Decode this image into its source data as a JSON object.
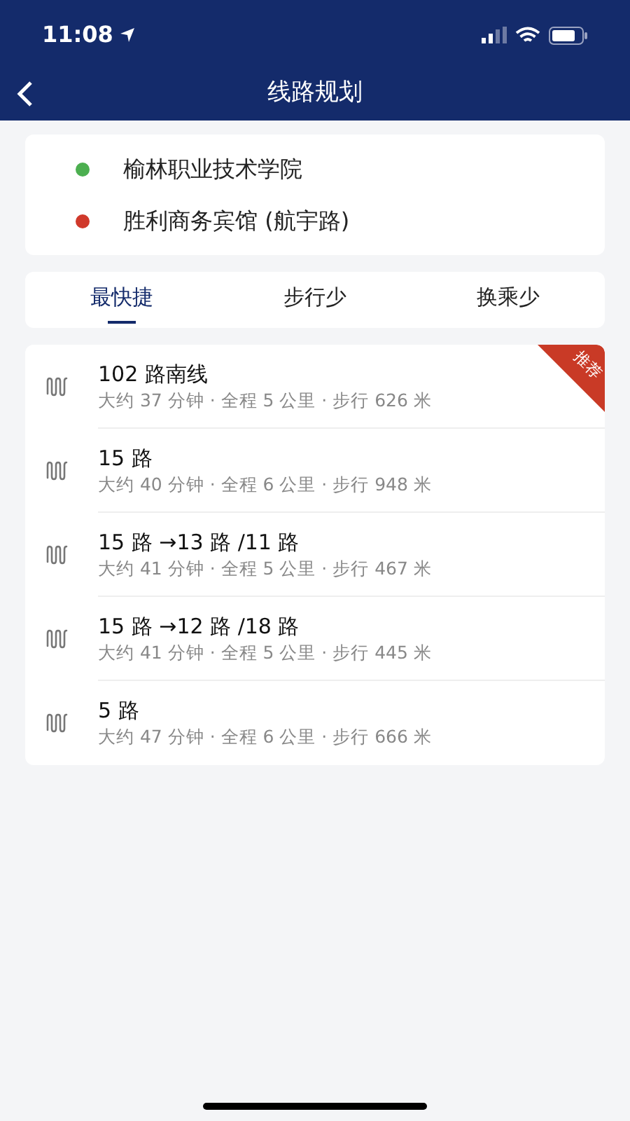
{
  "status_bar": {
    "time": "11:08"
  },
  "header": {
    "title": "线路规划"
  },
  "endpoints": [
    {
      "name": "榆林职业技术学院",
      "color": "#4caf50"
    },
    {
      "name": "胜利商务宾馆 (航宇路)",
      "color": "#d0392b"
    }
  ],
  "tabs": [
    {
      "label": "最快捷",
      "selected": true
    },
    {
      "label": "步行少",
      "selected": false
    },
    {
      "label": "换乘少",
      "selected": false
    }
  ],
  "routes": [
    {
      "name": "102 路南线",
      "details": "大约 37 分钟 · 全程 5 公里 · 步行 626 米",
      "badge": "推荐"
    },
    {
      "name": "15 路",
      "details": "大约 40 分钟 · 全程 6 公里 · 步行 948 米"
    },
    {
      "name": "15 路 →13 路 /11 路",
      "details": "大约 41 分钟 · 全程 5 公里 · 步行 467 米"
    },
    {
      "name": "15 路 →12 路 /18 路",
      "details": "大约 41 分钟 · 全程 5 公里 · 步行 445 米"
    },
    {
      "name": "5 路",
      "details": "大约 47 分钟 · 全程 6 公里 · 步行 666 米"
    }
  ]
}
